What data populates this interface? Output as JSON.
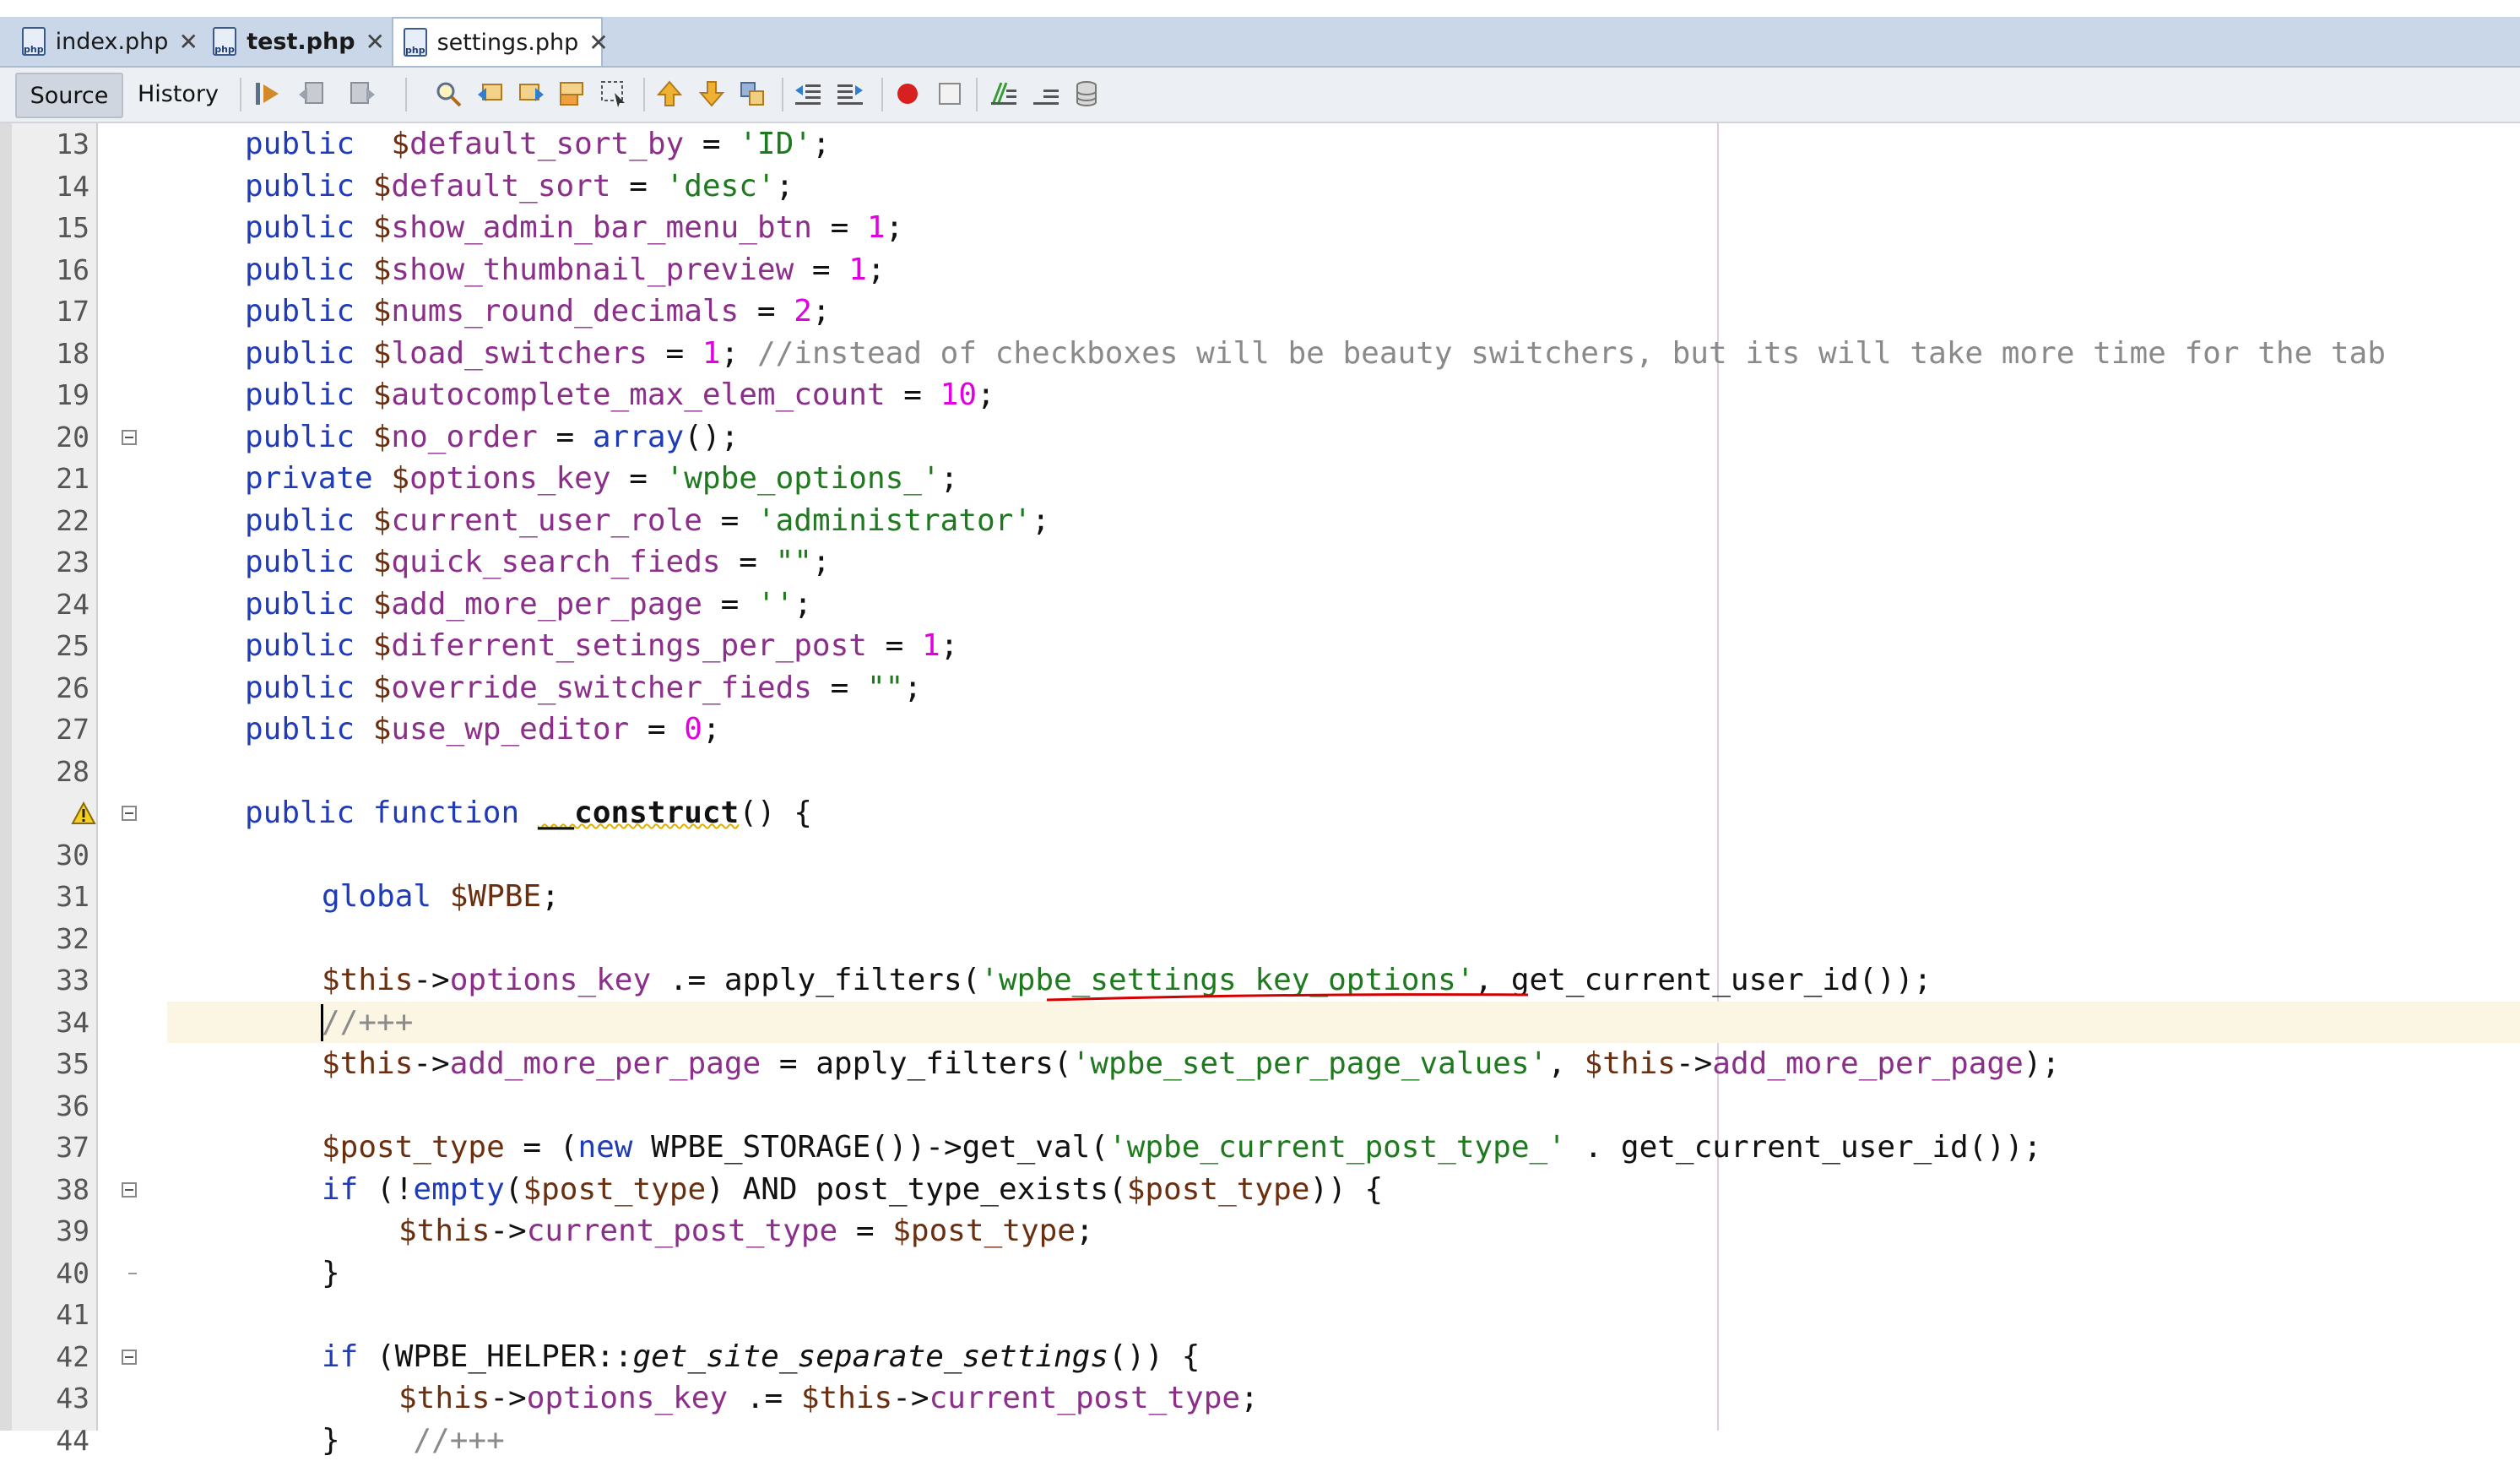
{
  "tabs": [
    {
      "label": "index.php",
      "icon": "php-file-icon",
      "active": false,
      "bold": false
    },
    {
      "label": "test.php",
      "icon": "php-file-icon",
      "active": false,
      "bold": true
    },
    {
      "label": "settings.php",
      "icon": "php-file-icon",
      "active": true,
      "bold": false
    }
  ],
  "tab_close_glyph": "✕",
  "tab_icon_text": "php",
  "toolbar": {
    "source_label": "Source",
    "history_label": "History",
    "icons": [
      "last-edit-icon",
      "back-icon",
      "forward-icon",
      "find-selection-icon",
      "find-previous-icon",
      "find-next-icon",
      "toggle-highlight-icon",
      "toggle-rect-selection-icon",
      "previous-bookmark-icon",
      "next-bookmark-icon",
      "toggle-bookmark-icon",
      "shift-left-icon",
      "shift-right-icon",
      "start-macro-icon",
      "stop-macro-icon",
      "comment-icon",
      "uncomment-icon",
      "database-icon"
    ]
  },
  "colors": {
    "keyword": "#1f3bb8",
    "property": "#8b2f8b",
    "dollar": "#6b2f10",
    "string": "#1f7a1f",
    "number": "#e000e0",
    "comment": "#8a8a8a",
    "current_line": "#fbf5e4",
    "squiggle": "#d40000"
  },
  "editor": {
    "current_line": "34",
    "lines": [
      {
        "num": "13",
        "code": [
          [
            "k",
            "public"
          ],
          [
            "",
            "  "
          ],
          [
            "d",
            "$"
          ],
          [
            "v",
            "default_sort_by"
          ],
          [
            "",
            " = "
          ],
          [
            "s",
            "'ID'"
          ],
          [
            "",
            ";"
          ]
        ]
      },
      {
        "num": "14",
        "code": [
          [
            "k",
            "public"
          ],
          [
            "",
            " "
          ],
          [
            "d",
            "$"
          ],
          [
            "v",
            "default_sort"
          ],
          [
            "",
            " = "
          ],
          [
            "s",
            "'desc'"
          ],
          [
            "",
            ";"
          ]
        ]
      },
      {
        "num": "15",
        "code": [
          [
            "k",
            "public"
          ],
          [
            "",
            " "
          ],
          [
            "d",
            "$"
          ],
          [
            "v",
            "show_admin_bar_menu_btn"
          ],
          [
            "",
            " = "
          ],
          [
            "n",
            "1"
          ],
          [
            "",
            ";"
          ]
        ]
      },
      {
        "num": "16",
        "code": [
          [
            "k",
            "public"
          ],
          [
            "",
            " "
          ],
          [
            "d",
            "$"
          ],
          [
            "v",
            "show_thumbnail_preview"
          ],
          [
            "",
            " = "
          ],
          [
            "n",
            "1"
          ],
          [
            "",
            ";"
          ]
        ]
      },
      {
        "num": "17",
        "code": [
          [
            "k",
            "public"
          ],
          [
            "",
            " "
          ],
          [
            "d",
            "$"
          ],
          [
            "v",
            "nums_round_decimals"
          ],
          [
            "",
            " = "
          ],
          [
            "n",
            "2"
          ],
          [
            "",
            ";"
          ]
        ]
      },
      {
        "num": "18",
        "code": [
          [
            "k",
            "public"
          ],
          [
            "",
            " "
          ],
          [
            "d",
            "$"
          ],
          [
            "v",
            "load_switchers"
          ],
          [
            "",
            " = "
          ],
          [
            "n",
            "1"
          ],
          [
            "",
            "; "
          ],
          [
            "c",
            "//instead of checkboxes will be beauty switchers, but its will take more time for the tab"
          ]
        ]
      },
      {
        "num": "19",
        "code": [
          [
            "k",
            "public"
          ],
          [
            "",
            " "
          ],
          [
            "d",
            "$"
          ],
          [
            "v",
            "autocomplete_max_elem_count"
          ],
          [
            "",
            " = "
          ],
          [
            "n",
            "10"
          ],
          [
            "",
            ";"
          ]
        ]
      },
      {
        "num": "20",
        "fold": true,
        "code": [
          [
            "k",
            "public"
          ],
          [
            "",
            " "
          ],
          [
            "d",
            "$"
          ],
          [
            "v",
            "no_order"
          ],
          [
            "",
            " = "
          ],
          [
            "k",
            "array"
          ],
          [
            "",
            "();"
          ]
        ]
      },
      {
        "num": "21",
        "code": [
          [
            "k",
            "private"
          ],
          [
            "",
            " "
          ],
          [
            "d",
            "$"
          ],
          [
            "v",
            "options_key"
          ],
          [
            "",
            " = "
          ],
          [
            "s",
            "'wpbe_options_'"
          ],
          [
            "",
            ";"
          ]
        ]
      },
      {
        "num": "22",
        "code": [
          [
            "k",
            "public"
          ],
          [
            "",
            " "
          ],
          [
            "d",
            "$"
          ],
          [
            "v",
            "current_user_role"
          ],
          [
            "",
            " = "
          ],
          [
            "s",
            "'administrator'"
          ],
          [
            "",
            ";"
          ]
        ]
      },
      {
        "num": "23",
        "code": [
          [
            "k",
            "public"
          ],
          [
            "",
            " "
          ],
          [
            "d",
            "$"
          ],
          [
            "v",
            "quick_search_fieds"
          ],
          [
            "",
            " = "
          ],
          [
            "s",
            "\"\""
          ],
          [
            "",
            ";"
          ]
        ]
      },
      {
        "num": "24",
        "code": [
          [
            "k",
            "public"
          ],
          [
            "",
            " "
          ],
          [
            "d",
            "$"
          ],
          [
            "v",
            "add_more_per_page"
          ],
          [
            "",
            " = "
          ],
          [
            "s",
            "''"
          ],
          [
            "",
            ";"
          ]
        ]
      },
      {
        "num": "25",
        "code": [
          [
            "k",
            "public"
          ],
          [
            "",
            " "
          ],
          [
            "d",
            "$"
          ],
          [
            "v",
            "diferrent_setings_per_post"
          ],
          [
            "",
            " = "
          ],
          [
            "n",
            "1"
          ],
          [
            "",
            ";"
          ]
        ]
      },
      {
        "num": "26",
        "code": [
          [
            "k",
            "public"
          ],
          [
            "",
            " "
          ],
          [
            "d",
            "$"
          ],
          [
            "v",
            "override_switcher_fieds"
          ],
          [
            "",
            " = "
          ],
          [
            "s",
            "\"\""
          ],
          [
            "",
            ";"
          ]
        ]
      },
      {
        "num": "27",
        "code": [
          [
            "k",
            "public"
          ],
          [
            "",
            " "
          ],
          [
            "d",
            "$"
          ],
          [
            "v",
            "use_wp_editor"
          ],
          [
            "",
            " = "
          ],
          [
            "n",
            "0"
          ],
          [
            "",
            ";"
          ]
        ]
      },
      {
        "num": "28",
        "code": []
      },
      {
        "num": "",
        "warning": true,
        "fold": true,
        "code": [
          [
            "k",
            "public"
          ],
          [
            "",
            " "
          ],
          [
            "k",
            "function"
          ],
          [
            "",
            " "
          ],
          [
            "bw",
            "__construct"
          ],
          [
            "",
            "() {"
          ]
        ]
      },
      {
        "num": "30",
        "code": []
      },
      {
        "num": "31",
        "indent": 1,
        "code": [
          [
            "k",
            "global"
          ],
          [
            "",
            " "
          ],
          [
            "d",
            "$WPBE"
          ],
          [
            "",
            ";"
          ]
        ]
      },
      {
        "num": "32",
        "code": []
      },
      {
        "num": "33",
        "indent": 1,
        "code": [
          [
            "d",
            "$this"
          ],
          [
            "",
            "->"
          ],
          [
            "v",
            "options_key"
          ],
          [
            "",
            " .= apply_filters("
          ],
          [
            "s",
            "'wpbe_settings_key_options'"
          ],
          [
            "",
            ", get_current_user_id());"
          ]
        ]
      },
      {
        "num": "34",
        "indent": 1,
        "current": true,
        "code": [
          [
            "c",
            "//+++"
          ]
        ]
      },
      {
        "num": "35",
        "indent": 1,
        "code": [
          [
            "d",
            "$this"
          ],
          [
            "",
            "->"
          ],
          [
            "v",
            "add_more_per_page"
          ],
          [
            "",
            " = apply_filters("
          ],
          [
            "s",
            "'wpbe_set_per_page_values'"
          ],
          [
            "",
            ", "
          ],
          [
            "d",
            "$this"
          ],
          [
            "",
            "->"
          ],
          [
            "v",
            "add_more_per_page"
          ],
          [
            "",
            ");"
          ]
        ]
      },
      {
        "num": "36",
        "code": []
      },
      {
        "num": "37",
        "indent": 1,
        "code": [
          [
            "d",
            "$post_type"
          ],
          [
            "",
            " = ("
          ],
          [
            "k",
            "new"
          ],
          [
            "",
            " WPBE_STORAGE())->get_val("
          ],
          [
            "s",
            "'wpbe_current_post_type_'"
          ],
          [
            "",
            " . get_current_user_id());"
          ]
        ]
      },
      {
        "num": "38",
        "indent": 1,
        "fold": true,
        "code": [
          [
            "k",
            "if"
          ],
          [
            "",
            " (!"
          ],
          [
            "k",
            "empty"
          ],
          [
            "",
            "("
          ],
          [
            "d",
            "$post_type"
          ],
          [
            "",
            ") AND post_type_exists("
          ],
          [
            "d",
            "$post_type"
          ],
          [
            "",
            ")) {"
          ]
        ]
      },
      {
        "num": "39",
        "indent": 2,
        "code": [
          [
            "d",
            "$this"
          ],
          [
            "",
            "->"
          ],
          [
            "v",
            "current_post_type"
          ],
          [
            "",
            " = "
          ],
          [
            "d",
            "$post_type"
          ],
          [
            "",
            ";"
          ]
        ]
      },
      {
        "num": "40",
        "indent": 1,
        "foldend": true,
        "code": [
          [
            "",
            "}"
          ]
        ]
      },
      {
        "num": "41",
        "code": []
      },
      {
        "num": "42",
        "indent": 1,
        "fold": true,
        "code": [
          [
            "k",
            "if"
          ],
          [
            "",
            " (WPBE_HELPER::"
          ],
          [
            "i",
            "get_site_separate_settings"
          ],
          [
            "",
            "()) {"
          ]
        ]
      },
      {
        "num": "43",
        "indent": 2,
        "code": [
          [
            "d",
            "$this"
          ],
          [
            "",
            "->"
          ],
          [
            "v",
            "options_key"
          ],
          [
            "",
            " .= "
          ],
          [
            "d",
            "$this"
          ],
          [
            "",
            "->"
          ],
          [
            "v",
            "current_post_type"
          ],
          [
            "",
            ";"
          ]
        ]
      },
      {
        "num": "44",
        "indent": 1,
        "code": [
          [
            "",
            "}    "
          ],
          [
            "c",
            "//+++"
          ]
        ]
      }
    ]
  }
}
